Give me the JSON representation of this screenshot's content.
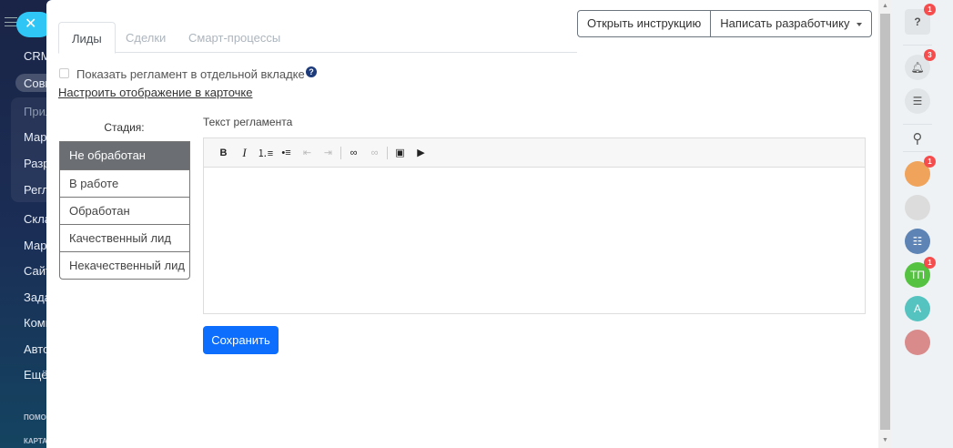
{
  "leftnav": {
    "items": [
      "CRM",
      "Совм",
      "Прил",
      "Марк",
      "Разр",
      "Регл",
      "Скла",
      "Марк",
      "Сайт",
      "Зада",
      "Комм",
      "Авто",
      "Ещё"
    ],
    "small": [
      "ПОМО",
      "КАРТА"
    ]
  },
  "tabs": [
    "Лиды",
    "Сделки",
    "Смарт-процессы"
  ],
  "actions": {
    "instructions": "Открыть инструкцию",
    "write_dev": "Написать разработчику"
  },
  "settings": {
    "show_tab_label": "Показать регламент в отдельной вкладке",
    "show_tab_checked": false,
    "help": "?",
    "configure_link": "Настроить отображение в карточке"
  },
  "stages": {
    "label": "Стадия:",
    "items": [
      "Не обработан",
      "В работе",
      "Обработан",
      "Качественный лид",
      "Некачественный лид"
    ]
  },
  "editor": {
    "label": "Текст регламента",
    "content": ""
  },
  "save": "Сохранить",
  "rail": {
    "help_badge": "1",
    "notif_badge": "3",
    "avatar1_badge": "1",
    "tp_initials": "ТП",
    "tp_badge": "1",
    "a_initials": "А"
  }
}
